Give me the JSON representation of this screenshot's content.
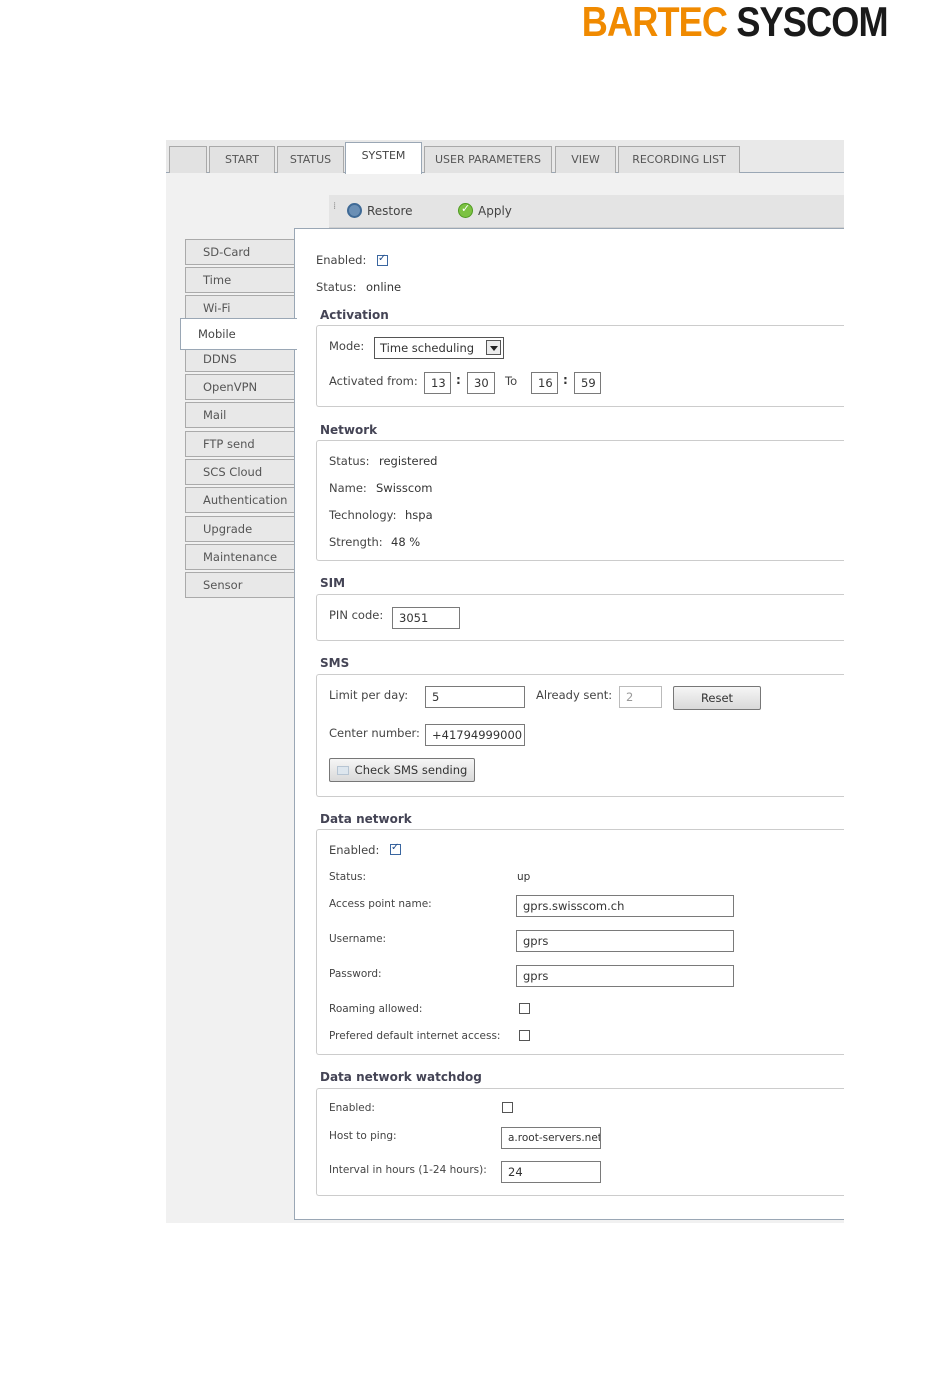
{
  "logo": {
    "part1": "BARTEC",
    "part2": "SYSCOM"
  },
  "tabs": [
    "",
    "START",
    "STATUS",
    "SYSTEM",
    "USER PARAMETERS",
    "VIEW",
    "RECORDING LIST"
  ],
  "toolbar": {
    "restore_label": "Restore",
    "apply_label": "Apply"
  },
  "sidebar": {
    "items": [
      "SD-Card",
      "Time",
      "Wi-Fi",
      "Mobile",
      "DDNS",
      "OpenVPN",
      "Mail",
      "FTP send",
      "SCS Cloud",
      "Authentication",
      "Upgrade",
      "Maintenance",
      "Sensor"
    ],
    "active": "Mobile"
  },
  "general": {
    "enabled_label": "Enabled:",
    "enabled": true,
    "status_label": "Status:",
    "status_value": "online"
  },
  "activation": {
    "title": "Activation",
    "mode_label": "Mode:",
    "mode_value": "Time scheduling",
    "from_label": "Activated from:",
    "from_hour": "13",
    "from_minute": "30",
    "to_label": "To",
    "to_hour": "16",
    "to_minute": "59",
    "colon": ":"
  },
  "network": {
    "title": "Network",
    "status_label": "Status:",
    "status_value": "registered",
    "name_label": "Name:",
    "name_value": "Swisscom",
    "tech_label": "Technology:",
    "tech_value": "hspa",
    "strength_label": "Strength:",
    "strength_value": "48 %"
  },
  "sim": {
    "title": "SIM",
    "pin_label": "PIN code:",
    "pin_value": "3051"
  },
  "sms": {
    "title": "SMS",
    "limit_label": "Limit per day:",
    "limit_value": "5",
    "sent_label": "Already sent:",
    "sent_value": "2",
    "reset_label": "Reset",
    "center_label": "Center number:",
    "center_value": "+41794999000",
    "check_label": "Check SMS sending"
  },
  "data_network": {
    "title": "Data network",
    "enabled_label": "Enabled:",
    "enabled": true,
    "status_label": "Status:",
    "status_value": "up",
    "apn_label": "Access point name:",
    "apn_value": "gprs.swisscom.ch",
    "username_label": "Username:",
    "username_value": "gprs",
    "password_label": "Password:",
    "password_value": "gprs",
    "roaming_label": "Roaming allowed:",
    "roaming": false,
    "default_label": "Prefered default internet access:",
    "default_access": false
  },
  "watchdog": {
    "title": "Data network watchdog",
    "enabled_label": "Enabled:",
    "enabled": false,
    "host_label": "Host to ping:",
    "host_value": "a.root-servers.net",
    "interval_label": "Interval in hours (1-24 hours):",
    "interval_value": "24"
  }
}
